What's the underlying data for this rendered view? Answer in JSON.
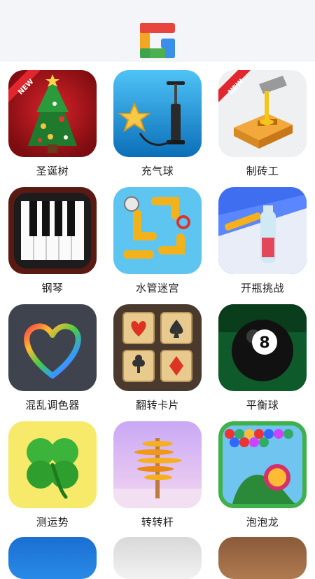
{
  "header": {
    "logo_icon": "colored-blocks-logo-icon"
  },
  "badge_text": "NEW",
  "apps": [
    {
      "label": "圣诞树",
      "icon": "christmas-tree-icon",
      "is_new": true
    },
    {
      "label": "充气球",
      "icon": "balloon-pump-icon",
      "is_new": false
    },
    {
      "label": "制砖工",
      "icon": "brick-maker-icon",
      "is_new": true
    },
    {
      "label": "钢琴",
      "icon": "piano-icon",
      "is_new": false
    },
    {
      "label": "水管迷宫",
      "icon": "pipe-maze-icon",
      "is_new": false
    },
    {
      "label": "开瓶挑战",
      "icon": "bottle-flip-icon",
      "is_new": false
    },
    {
      "label": "混乱调色器",
      "icon": "rainbow-heart-icon",
      "is_new": false
    },
    {
      "label": "翻转卡片",
      "icon": "flip-cards-icon",
      "is_new": false
    },
    {
      "label": "平衡球",
      "icon": "eight-ball-icon",
      "is_new": false
    },
    {
      "label": "测运势",
      "icon": "four-leaf-clover-icon",
      "is_new": false
    },
    {
      "label": "转转杆",
      "icon": "spinning-pole-icon",
      "is_new": false
    },
    {
      "label": "泡泡龙",
      "icon": "bubble-shooter-icon",
      "is_new": false
    }
  ]
}
